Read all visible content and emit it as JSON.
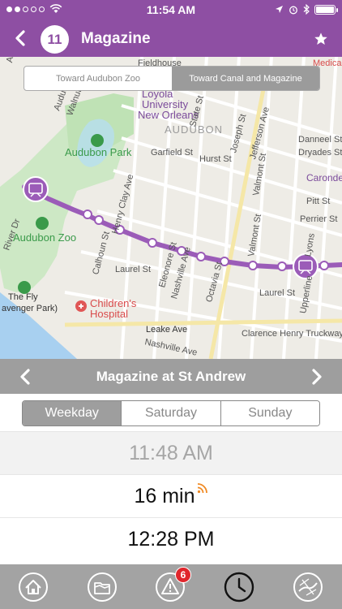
{
  "status_bar": {
    "time": "11:54 AM",
    "signal_dots": 5,
    "signal_filled": 2
  },
  "nav": {
    "route_number": "11",
    "title": "Magazine",
    "accent_color": "#8e4fa3"
  },
  "map": {
    "direction_options": [
      "Toward Audubon Zoo",
      "Toward Canal and Magazine"
    ],
    "selected_direction": "Toward Canal and Magazine",
    "labels": {
      "fieldhouse": "Fieldhouse",
      "medical": "Medica",
      "ave": "Ave",
      "audubon_st": "Audubon",
      "walnut_st": "Walnut St",
      "loyola": "Loyola",
      "university": "University",
      "new_orleans": "New Orleans",
      "state_st": "State St",
      "joseph_st": "Joseph St",
      "jefferson_ave": "Jefferson Ave",
      "audubon_district": "AUDUBON",
      "audubon_park": "Audubon Park",
      "garfield_st": "Garfield St",
      "hurst_st": "Hurst St",
      "danneel_st": "Danneel St",
      "dryades_st": "Dryades St",
      "carondelet": "Caronde",
      "henry_clay_ave": "Henry Clay Ave",
      "pitt_st": "Pitt St",
      "perrier_st": "Perrier St",
      "audubon_zoo": "Audubon Zoo",
      "river_dr": "River Dr",
      "calhoun_st": "Calhoun St",
      "laurel_st_1": "Laurel St",
      "laurel_st_2": "Laurel St",
      "eleonore_st": "Eleonore St",
      "nashville_ave_1": "Nashville Ave",
      "octavia_st": "Octavia St",
      "valmont_st_1": "Valmont St",
      "valmont_st_2": "Valmont St",
      "lyons": "Lyons",
      "upperline": "Upperline",
      "the_fly": "The Fly",
      "riverview": "avenger Park)",
      "childrens_hospital_1": "Children's",
      "childrens_hospital_2": "Hospital",
      "leake_ave": "Leake Ave",
      "clarence_henry": "Clarence Henry Truckway",
      "nashville_ave_2": "Nashville Ave"
    }
  },
  "stop": {
    "name": "Magazine at St Andrew"
  },
  "days": {
    "tabs": [
      "Weekday",
      "Saturday",
      "Sunday"
    ],
    "selected": "Weekday"
  },
  "times": {
    "past": "11:48 AM",
    "live": "16 min",
    "next": "12:28 PM"
  },
  "tab_bar": {
    "alerts_count": "6",
    "items": [
      "home-icon",
      "map-folder-icon",
      "alert-icon",
      "clock-icon",
      "route-map-icon"
    ],
    "selected": "clock-icon"
  }
}
